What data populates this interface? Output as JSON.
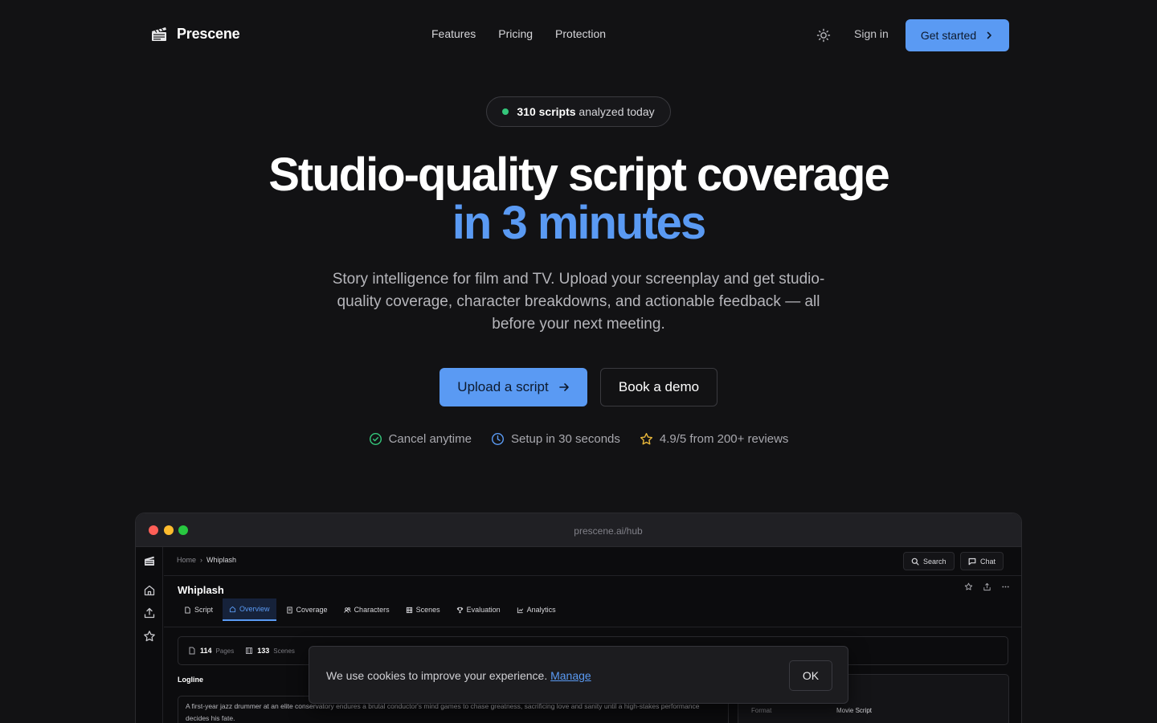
{
  "brand": {
    "name": "Prescene",
    "logo_icon": "clapperboard-icon"
  },
  "nav": {
    "links": [
      "Features",
      "Pricing",
      "Protection"
    ],
    "theme_icon": "sun-icon",
    "signin": "Sign in",
    "cta": "Get started"
  },
  "hero": {
    "badge_count": "310 scripts",
    "badge_rest": " analyzed today",
    "title_line1": "Studio-quality script coverage",
    "title_line2": "in 3 minutes",
    "subtitle": "Story intelligence for film and TV. Upload your screenplay and get studio-quality coverage, character breakdowns, and actionable feedback — all before your next meeting.",
    "primary_cta": "Upload a script",
    "secondary_cta": "Book a demo",
    "trust": [
      {
        "icon": "check-circle-icon",
        "text": "Cancel anytime"
      },
      {
        "icon": "clock-icon",
        "text": "Setup in 30 seconds"
      },
      {
        "icon": "star-icon",
        "text": "4.9/5 from 200+ reviews"
      }
    ],
    "colors": {
      "accent": "#5a9af3",
      "badge_dot": "#34c77b"
    }
  },
  "app_window": {
    "url": "prescene.ai/hub",
    "breadcrumb": {
      "home": "Home",
      "separator": "›",
      "current": "Whiplash"
    },
    "search_label": "Search",
    "chat_label": "Chat",
    "doc_title": "Whiplash",
    "tabs": [
      {
        "label": "Script",
        "icon": "file-icon"
      },
      {
        "label": "Overview",
        "icon": "home-icon",
        "active": true
      },
      {
        "label": "Coverage",
        "icon": "document-icon"
      },
      {
        "label": "Characters",
        "icon": "users-icon"
      },
      {
        "label": "Scenes",
        "icon": "film-icon"
      },
      {
        "label": "Evaluation",
        "icon": "trophy-icon"
      },
      {
        "label": "Analytics",
        "icon": "chart-icon"
      }
    ],
    "stats": [
      {
        "value": "114",
        "label": "Pages"
      },
      {
        "value": "133",
        "label": "Scenes"
      }
    ],
    "logline_label": "Logline",
    "logline": "A first-year jazz drummer at an elite conservatory endures a brutal conductor's mind games to chase greatness, sacrificing love and sanity until a high-stakes performance decides his fate.",
    "meta": {
      "key": "Format",
      "value": "Movie Script"
    }
  },
  "cookie": {
    "text": "We use cookies to improve your experience.",
    "link": "Manage",
    "ok": "OK"
  }
}
